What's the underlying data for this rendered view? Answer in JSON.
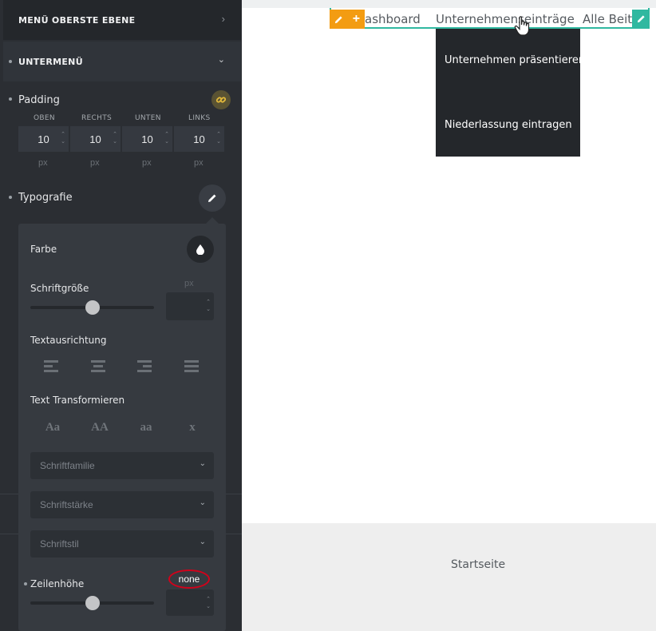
{
  "sidebar": {
    "top_menu_label": "MENÜ OBERSTE EBENE",
    "submenu_label": "UNTERMENÜ",
    "padding_label": "Padding",
    "padding_headers": [
      "OBEN",
      "RECHTS",
      "UNTEN",
      "LINKS"
    ],
    "padding_values": [
      "10",
      "10",
      "10",
      "10"
    ],
    "padding_unit": "px",
    "typography_label": "Typografie"
  },
  "typography_panel": {
    "color_label": "Farbe",
    "font_size_label": "Schriftgröße",
    "font_size_unit": "px",
    "font_size_value": "",
    "font_size_slider": 0.5,
    "text_align_label": "Textausrichtung",
    "text_transform_label": "Text Transformieren",
    "transform_options": [
      "Aa",
      "AA",
      "aa",
      "x"
    ],
    "font_family_placeholder": "Schriftfamilie",
    "font_weight_placeholder": "Schriftstärke",
    "font_style_placeholder": "Schriftstil",
    "line_height_label": "Zeilenhöhe",
    "line_height_annotation": "none",
    "line_height_slider": 0.5
  },
  "preview": {
    "nav_items": [
      "ashboard",
      "Unternehmenseinträge",
      "Alle Beitra"
    ],
    "dropdown_items": [
      "Unternehmen präsentieren",
      "Niederlassung eintragen"
    ],
    "footer_text": "Startseite"
  },
  "colors": {
    "accent_orange": "#f39c12",
    "accent_teal": "#30b8a0",
    "link_icon_gold": "#c9a227",
    "annotation_red": "#d0021b"
  }
}
